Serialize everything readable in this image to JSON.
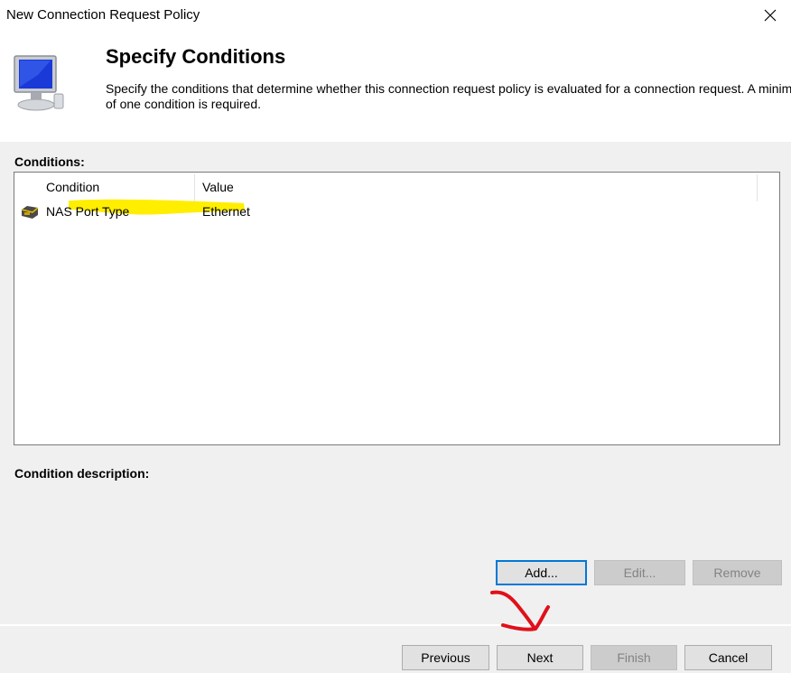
{
  "window": {
    "title": "New Connection Request Policy"
  },
  "header": {
    "title": "Specify Conditions",
    "description": "Specify the conditions that determine whether this connection request policy is evaluated for a connection request. A minimum of one condition is required."
  },
  "conditions": {
    "label": "Conditions:",
    "columns": [
      "Condition",
      "Value"
    ],
    "rows": [
      {
        "condition": "NAS Port Type",
        "value": "Ethernet"
      }
    ]
  },
  "description_section": {
    "label": "Condition description:"
  },
  "condition_buttons": {
    "add": "Add...",
    "edit": "Edit...",
    "remove": "Remove"
  },
  "footer_buttons": {
    "previous": "Previous",
    "next": "Next",
    "finish": "Finish",
    "cancel": "Cancel"
  },
  "colors": {
    "highlight": "#ffee00",
    "annotation": "#e0101a"
  }
}
